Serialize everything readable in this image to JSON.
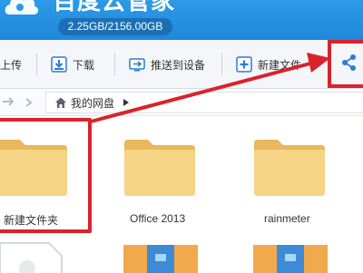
{
  "app": {
    "title": "百度云管家",
    "storage": "2.25GB/2156.00GB"
  },
  "toolbar": {
    "upload_label": "上传",
    "download_label": "下载",
    "push_label": "推送到设备",
    "new_folder_label": "新建文件"
  },
  "address": {
    "path_label": "我的网盘"
  },
  "files": [
    {
      "name": "新建文件夹",
      "type": "folder"
    },
    {
      "name": "Office 2013",
      "type": "folder"
    },
    {
      "name": "rainmeter",
      "type": "folder"
    }
  ],
  "colors": {
    "header_blue": "#2291e0",
    "folder_yellow": "#f5cf7b",
    "annotation_red": "#d9232c"
  }
}
